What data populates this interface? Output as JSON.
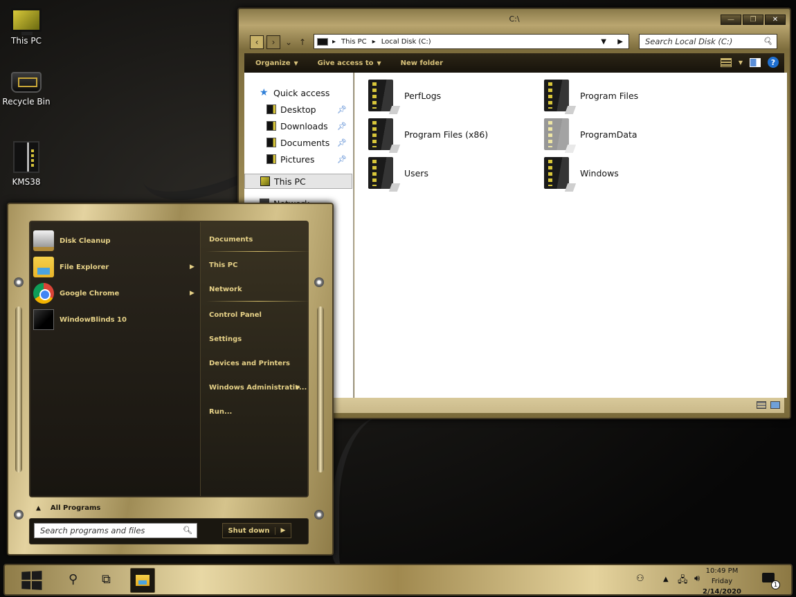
{
  "desktop": {
    "icons": [
      {
        "label": "This PC",
        "icon": "monitor-icon"
      },
      {
        "label": "Recycle Bin",
        "icon": "recycle-bin-icon"
      },
      {
        "label": "KMS38",
        "icon": "kms-icon"
      }
    ]
  },
  "explorer": {
    "title": "C:\\",
    "controls": {
      "minimize": "—",
      "maximize": "❐",
      "close": "✕"
    },
    "nav": {
      "back": "‹",
      "forward": "›",
      "recent": "⌄",
      "up": "↑"
    },
    "breadcrumb": [
      "This PC",
      "Local Disk (C:)"
    ],
    "search_placeholder": "Search Local Disk (C:)",
    "commands": {
      "organize": "Organize",
      "give_access": "Give access to",
      "new_folder": "New folder"
    },
    "navpane": {
      "quick_access": "Quick access",
      "items": [
        "Desktop",
        "Downloads",
        "Documents",
        "Pictures"
      ],
      "this_pc": "This PC",
      "network": "Network"
    },
    "folders": [
      {
        "name": "PerfLogs",
        "faded": false
      },
      {
        "name": "Program Files",
        "faded": false
      },
      {
        "name": "Program Files (x86)",
        "faded": false
      },
      {
        "name": "ProgramData",
        "faded": true
      },
      {
        "name": "Users",
        "faded": false
      },
      {
        "name": "Windows",
        "faded": false
      }
    ]
  },
  "startmenu": {
    "programs": [
      {
        "label": "Disk Cleanup",
        "icon": "disk-cleanup-icon",
        "submenu": false
      },
      {
        "label": "File Explorer",
        "icon": "file-explorer-icon",
        "submenu": true
      },
      {
        "label": "Google Chrome",
        "icon": "chrome-icon",
        "submenu": true
      },
      {
        "label": "WindowBlinds 10",
        "icon": "windowblinds-icon",
        "submenu": false
      }
    ],
    "links": [
      "Documents",
      "This PC",
      "Network",
      "Control Panel",
      "Settings",
      "Devices and Printers",
      "Windows Administrativ...",
      "Run..."
    ],
    "all_programs": "All Programs",
    "search_placeholder": "Search programs and files",
    "shutdown": "Shut down"
  },
  "taskbar": {
    "time": "10:49 PM",
    "day": "Friday",
    "date": "2/14/2020",
    "notification_count": "1"
  },
  "colors": {
    "accent_gold": "#e7d288",
    "frame_gold": "#b9a56f",
    "dark_panel": "#1c1914"
  }
}
